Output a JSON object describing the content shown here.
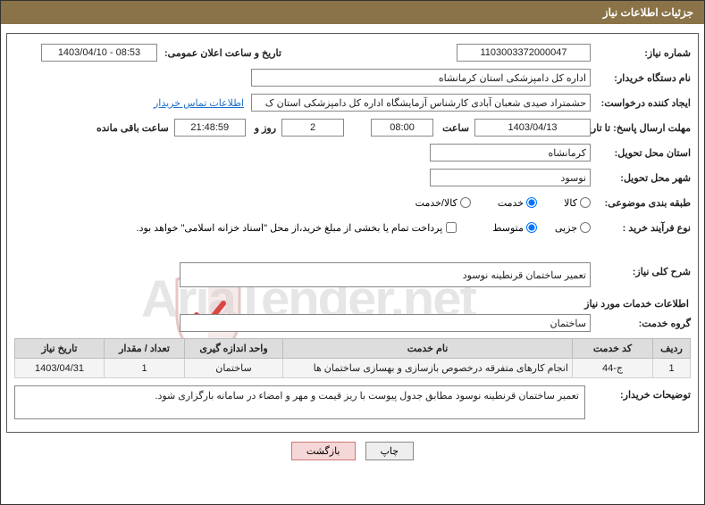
{
  "header": {
    "title": "جزئیات اطلاعات نیاز"
  },
  "watermark_text": "AriaTender.net",
  "labels": {
    "need_no": "شماره نیاز:",
    "announce_dt": "تاریخ و ساعت اعلان عمومی:",
    "org_name": "نام دستگاه خریدار:",
    "requester": "ایجاد کننده درخواست:",
    "contact_link": "اطلاعات تماس خریدار",
    "deadline_to": "مهلت ارسال پاسخ: تا تاریخ:",
    "hour": "ساعت",
    "days_and": "روز و",
    "remaining": "ساعت باقی مانده",
    "delivery_province": "استان محل تحویل:",
    "delivery_city": "شهر محل تحویل:",
    "category": "طبقه بندی موضوعی:",
    "cat_goods": "کالا",
    "cat_service": "خدمت",
    "cat_both": "کالا/خدمت",
    "purchase_type": "نوع فرآیند خرید :",
    "pt_minor": "جزیی",
    "pt_medium": "متوسط",
    "treasury_note": "پرداخت تمام یا بخشی از مبلغ خرید،از محل \"اسناد خزانه اسلامی\" خواهد بود.",
    "main_desc": "شرح کلی نیاز:",
    "svc_section": "اطلاعات خدمات مورد نیاز",
    "svc_group": "گروه خدمت:",
    "buyer_notes": "توضیحات خریدار:"
  },
  "fields": {
    "need_no": "1103003372000047",
    "announce_dt": "1403/04/10 - 08:53",
    "org_name": "اداره کل دامپزشکی استان کرمانشاه",
    "requester": "حشمتراد صیدی شعبان آبادی کارشناس آزمایشگاه اداره کل دامپزشکی استان ک",
    "deadline_date": "1403/04/13",
    "deadline_hour": "08:00",
    "days_left": "2",
    "time_left": "21:48:59",
    "delivery_province": "کرمانشاه",
    "delivery_city": "نوسود",
    "main_desc": "تعمیر ساختمان قرنطینه نوسود",
    "svc_group": "ساختمان",
    "buyer_notes": "تعمیر ساختمان قرنطینه نوسود مطابق جدول پیوست با ریز قیمت و مهر و امضاء در سامانه بارگزاری شود."
  },
  "svc_table": {
    "headers": [
      "ردیف",
      "کد خدمت",
      "نام خدمت",
      "واحد اندازه گیری",
      "تعداد / مقدار",
      "تاریخ نیاز"
    ],
    "row": {
      "idx": "1",
      "code": "ج-44",
      "name": "انجام کارهای متفرقه درخصوص بازسازی و بهسازی ساختمان ها",
      "unit": "ساختمان",
      "qty": "1",
      "date": "1403/04/31"
    }
  },
  "buttons": {
    "print": "چاپ",
    "back": "بازگشت"
  }
}
